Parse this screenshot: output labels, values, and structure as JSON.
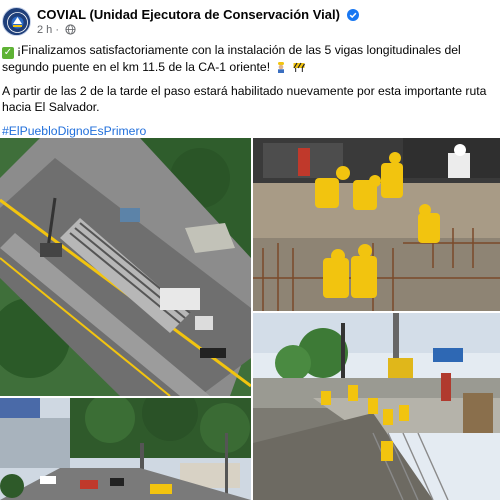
{
  "post": {
    "page_name": "COVIAL (Unidad Ejecutora de Conservación Vial)",
    "time_ago": "2 h",
    "visibility_icon": "globe-icon",
    "verified_icon": "verified-badge-icon",
    "text_line1": "¡Finalizamos satisfactoriamente con la instalación de las 5 vigas longitudinales del segundo puente en el km 11.5 de la CA-1 oriente!",
    "text_line2": "A partir de las 2 de la tarde el paso estará habilitado nuevamente por esta importante ruta hacia El Salvador.",
    "hashtag": "#ElPuebloDignoEsPrimero"
  },
  "photos": [
    {
      "name": "aerial-bridge-photo",
      "subject": "Aerial view of highway with bridge beams and crane"
    },
    {
      "name": "workers-rebar-photo",
      "subject": "Workers in yellow vests placing rebar on bridge beams"
    },
    {
      "name": "bridge-crane-photo",
      "subject": "Workers on bridge deck with crane"
    },
    {
      "name": "highway-city-photo",
      "subject": "Highway with traffic and city buildings"
    }
  ],
  "colors": {
    "brand_blue": "#216fdb",
    "verified_blue": "#1877f2",
    "safety_yellow": "#f2c40f"
  }
}
